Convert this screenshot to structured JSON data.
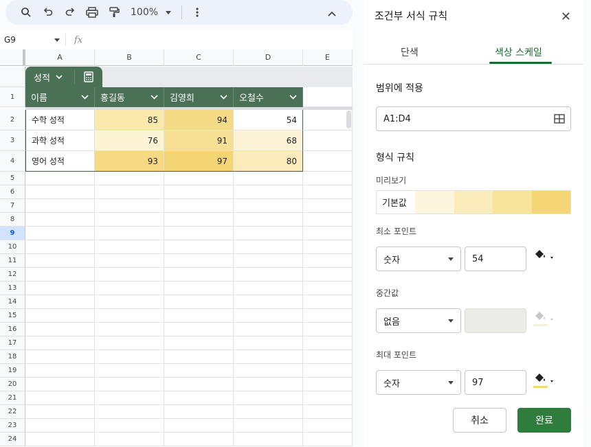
{
  "toolbar": {
    "zoom": "100%"
  },
  "formula_bar": {
    "cell_ref": "G9",
    "fx_label": "fx"
  },
  "columns": [
    "A",
    "B",
    "C",
    "D",
    "E"
  ],
  "rows": [
    "1",
    "2",
    "3",
    "4",
    "5",
    "6",
    "7",
    "8",
    "9",
    "10",
    "11",
    "12",
    "13",
    "14",
    "15",
    "16",
    "17",
    "18",
    "19",
    "20",
    "21",
    "22",
    "23",
    "24"
  ],
  "selected_row": "9",
  "table": {
    "name": "성적",
    "headers": [
      "이름",
      "홍길동",
      "김영희",
      "오철수"
    ],
    "data": [
      {
        "label": "수학 성적",
        "values": [
          "85",
          "94",
          "54"
        ]
      },
      {
        "label": "과학 성적",
        "values": [
          "76",
          "91",
          "68"
        ]
      },
      {
        "label": "영어 성적",
        "values": [
          "93",
          "97",
          "80"
        ]
      }
    ],
    "cell_colors": [
      [
        "#f9e9ad",
        "#f6db86",
        "#ffffff"
      ],
      [
        "#fcf4d4",
        "#f7df93",
        "#fcf3d6"
      ],
      [
        "#f6da83",
        "#f4d574",
        "#faecba"
      ]
    ],
    "header_color": "#4a7156"
  },
  "panel": {
    "title": "조건부 서식 규칙",
    "tabs": [
      "단색",
      "색상 스케일"
    ],
    "active_tab": "색상 스케일",
    "apply_range_label": "범위에 적용",
    "range_value": "A1:D4",
    "format_rules_label": "형식 규칙",
    "preview_label": "미리보기",
    "preview_text": "기본값",
    "preview_colors": [
      "#fdf6df",
      "#faebba",
      "#f8e39a",
      "#f5d676"
    ],
    "min": {
      "label": "최소 포인트",
      "type": "숫자",
      "value": "54",
      "color": "#ffffff"
    },
    "mid": {
      "label": "중간값",
      "type": "없음",
      "value": "",
      "color": "#f7f1d8"
    },
    "max": {
      "label": "최대 포인트",
      "type": "숫자",
      "value": "97",
      "color": "#f4d676"
    },
    "cancel_label": "취소",
    "done_label": "완료"
  }
}
